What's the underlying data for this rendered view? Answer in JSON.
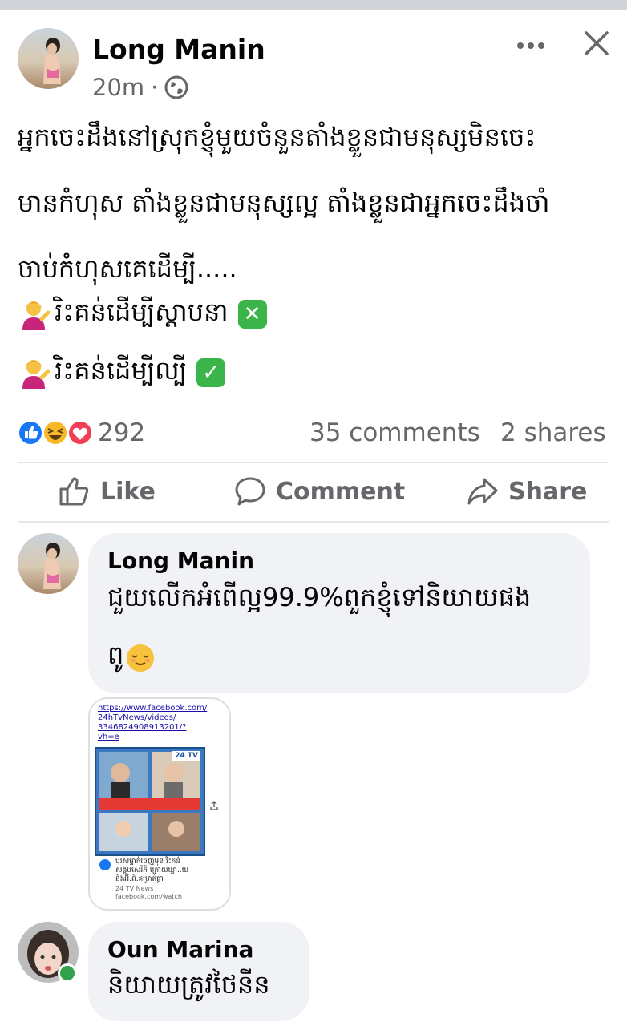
{
  "post": {
    "author": "Long Manin",
    "time": "20m",
    "separator": "·",
    "lines": [
      "អ្នកចេះដឹងនៅស្រុកខ្ញុំមួយចំនួនតាំងខ្លួនជាមនុស្សមិនចេះ",
      "មានកំហុស តាំងខ្លួនជាមនុស្សល្អ តាំងខ្លួនជាអ្នកចេះដឹងចាំ",
      "ចាប់កំហុសគេដើម្បី....."
    ],
    "option1": "រិះគន់ដើម្បីស្តាបនា",
    "option2": "រិះគន់ដើម្បីល្បី",
    "reaction_count": "292",
    "comments": "35 comments",
    "shares": "2 shares"
  },
  "actions": {
    "like": "Like",
    "comment": "Comment",
    "share": "Share"
  },
  "comments": [
    {
      "author": "Long Manin",
      "lines": [
        "ជួយលើកអំពើល្អ99.9%ពួកខ្ញុំទៅនិយាយផង",
        "ពូ"
      ]
    },
    {
      "author": "Oun Marina",
      "lines": [
        "និយាយត្រូវថៃនីន"
      ]
    }
  ],
  "attachment": {
    "url_lines": [
      "https://www.facebook.com/",
      "24hTvNews/videos/",
      "3346824908913201/?",
      "vh=e"
    ],
    "logo": "24 TV",
    "caption_lines": [
      "បុរសម្នាក់ចេញមុខ រិះគន់",
      "សង្គមសេរីភី ក្រោយឃ្លា..យ",
      "និងអ៊ី.ពិ.គម្រាត់ផ្កា"
    ],
    "source": "24 TV News",
    "domain": "facebook.com/watch"
  },
  "colors": {
    "like_blue": "#1877f2",
    "text_gray": "#65676b",
    "bubble_bg": "#f0f2f5",
    "online_green": "#31a24c"
  }
}
